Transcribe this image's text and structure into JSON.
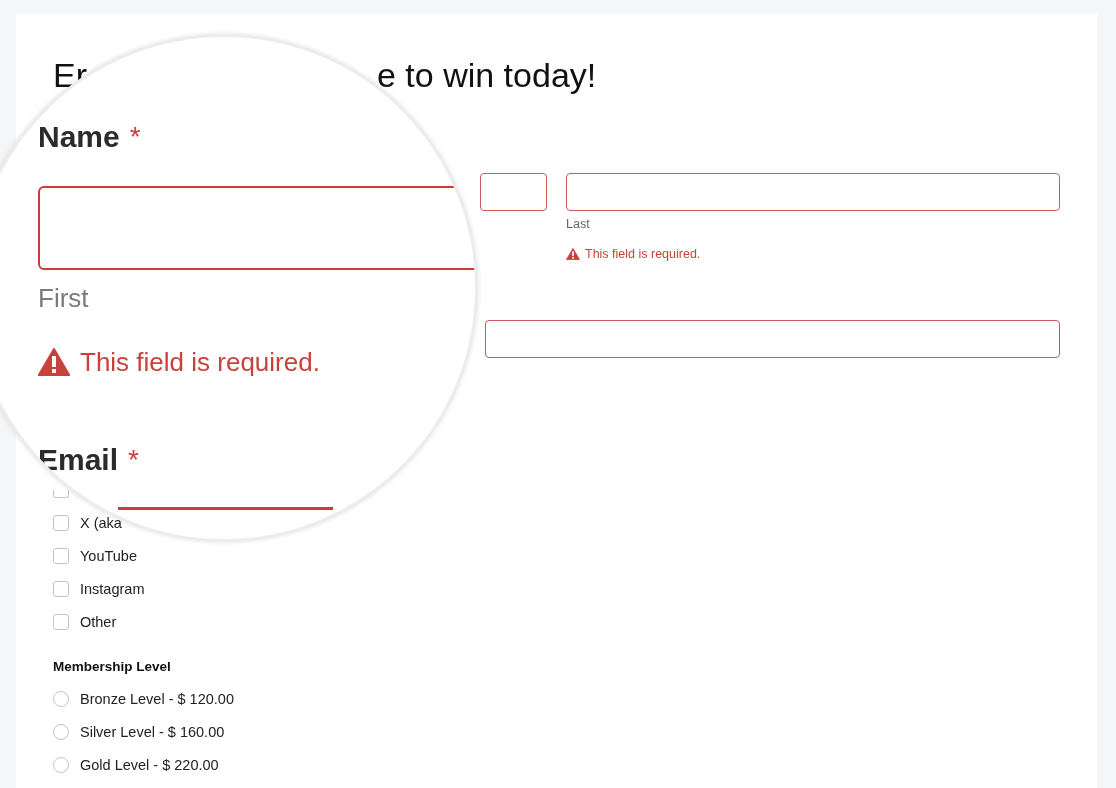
{
  "page": {
    "title_fragments": [
      "Er",
      "e to win today!"
    ],
    "name_fields": [
      {
        "invalid": true
      },
      {
        "invalid": true,
        "sublabel": "Last",
        "error": "This field is required."
      }
    ],
    "email_field": {
      "invalid": true
    },
    "checkboxes": [
      {
        "checked": false
      },
      {
        "label": "X (aka",
        "checked": false
      },
      {
        "label": "YouTube",
        "checked": false
      },
      {
        "label": "Instagram",
        "checked": false
      },
      {
        "label": "Other",
        "checked": false
      }
    ],
    "radio_group": {
      "label": "Membership Level",
      "options": [
        {
          "label": "Bronze Level - $ 120.00",
          "selected": false
        },
        {
          "label": "Silver Level - $ 160.00",
          "selected": false
        },
        {
          "label": "Gold Level - $ 220.00",
          "selected": false
        }
      ]
    }
  },
  "magnifier": {
    "name_label": "Name",
    "name_required_mark": "*",
    "name_field_invalid": true,
    "sublabel": "First",
    "error": "This field is required.",
    "email_label": "Email",
    "email_required_mark": "*",
    "email_field_invalid": true
  }
}
